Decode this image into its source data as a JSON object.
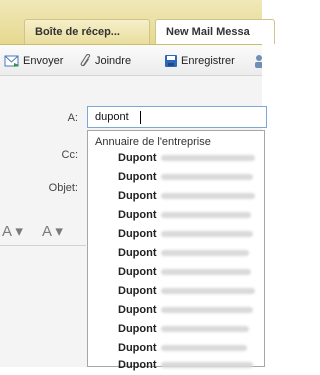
{
  "tabs": [
    {
      "label": "Boîte de récep..."
    },
    {
      "label": "New Mail Messa"
    }
  ],
  "toolbar": {
    "send_label": "Envoyer",
    "attach_label": "Joindre",
    "save_label": "Enregistrer"
  },
  "form": {
    "to_label": "A:",
    "to_value": "dupont",
    "cc_label": "Cc:",
    "subject_label": "Objet:"
  },
  "format_bar": {
    "font_icon": "A ▾",
    "style_icon": "A ▾"
  },
  "autocomplete": {
    "header": "Annuaire de l'entreprise",
    "entries": [
      "Dupont",
      "Dupont",
      "Dupont",
      "Dupont",
      "Dupont",
      "Dupont",
      "Dupont",
      "Dupont",
      "Dupont",
      "Dupont",
      "Dupont",
      "Dupont"
    ]
  }
}
